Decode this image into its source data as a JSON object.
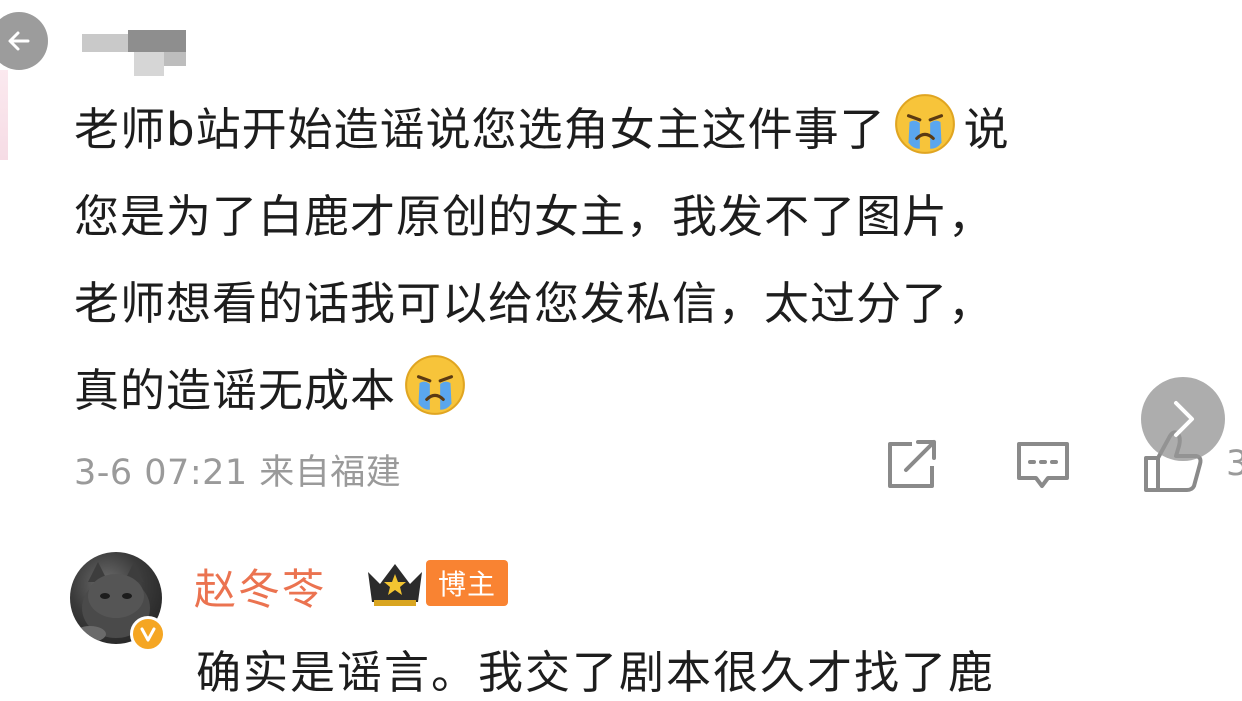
{
  "comment": {
    "lines": [
      "老师b站开始造谣说您选角女主这件事了",
      "说",
      "您是为了白鹿才原创的女主，我发不了图片，",
      "老师想看的话我可以给您发私信，太过分了，",
      "真的造谣无成本"
    ],
    "emoji_icon": "crying-face-icon",
    "timestamp": "3-6 07:21",
    "source": "来自福建",
    "like_count": "3"
  },
  "reply": {
    "author": "赵冬苓",
    "badge_label": "博主",
    "text": "确实是谣言。我交了剧本很久才找了鹿"
  },
  "colors": {
    "author_name": "#eb7350",
    "badge_bg": "#f98332",
    "meta_text": "#9a9a9a",
    "verified": "#f5a623"
  }
}
